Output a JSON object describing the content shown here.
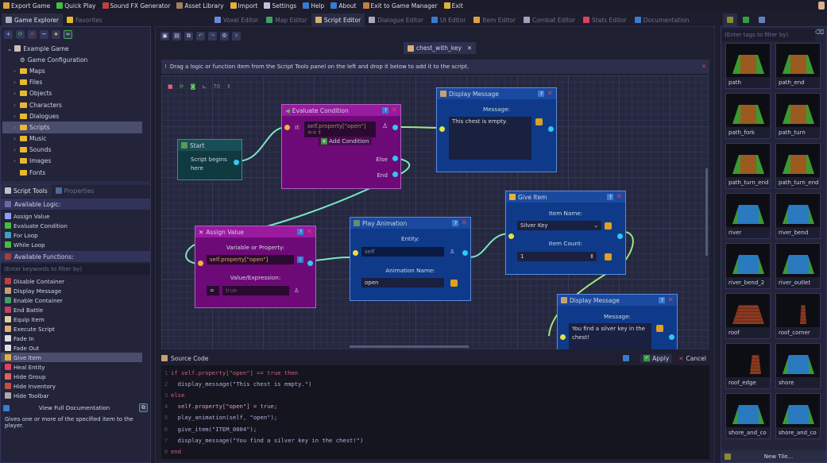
{
  "menu": [
    "Export Game",
    "Quick Play",
    "Sound FX Generator",
    "Asset Library",
    "Import",
    "Settings",
    "Help",
    "About",
    "Exit to Game Manager",
    "Exit"
  ],
  "left_tabs": [
    "Game Explorer",
    "Favorites"
  ],
  "editor_tabs": [
    "Voxel Editor",
    "Map Editor",
    "Script Editor",
    "Dialogue Editor",
    "UI Editor",
    "Item Editor",
    "Combat Editor",
    "Stats Editor",
    "Documentation"
  ],
  "active_editor_tab": "Script Editor",
  "tree": {
    "root": "Example Game",
    "items": [
      "Game Configuration",
      "Maps",
      "Files",
      "Objects",
      "Characters",
      "Dialogues",
      "Scripts",
      "Music",
      "Sounds",
      "Images",
      "Fonts"
    ],
    "selected": "Scripts"
  },
  "tool_tabs": [
    "Script Tools",
    "Properties"
  ],
  "logic": {
    "header": "Available Logic:",
    "items": [
      "Assign Value",
      "Evaluate Condition",
      "For Loop",
      "While Loop"
    ]
  },
  "functions": {
    "header": "Available Functions:",
    "placeholder": "(Enter keywords to filter by)",
    "items": [
      "Disable Container",
      "Display Message",
      "Enable Container",
      "End Battle",
      "Equip Item",
      "Execute Script",
      "Fade In",
      "Fade Out",
      "Give Item",
      "Heal Entity",
      "Hide Group",
      "Hide Inventory",
      "Hide Toolbar"
    ],
    "selected": "Give Item"
  },
  "view_docs": "View Full Documentation",
  "description": "Gives one or more of the specified item to the player.",
  "script_tab": "chest_with_key",
  "hint": "Drag a logic or function item from the Script Tools panel on the left and drop it below to add it to the script.",
  "zoom": "70",
  "nodes": {
    "start": {
      "title": "Start",
      "text": "Script begins here"
    },
    "evaluate": {
      "title": "Evaluate Condition",
      "if_label": "If:",
      "condition": "self.property[\"open\"] == t",
      "add": "Add Condition",
      "else": "Else",
      "end": "End"
    },
    "display1": {
      "title": "Display Message",
      "label": "Message:",
      "value": "This chest is empty."
    },
    "assign": {
      "title": "Assign Value",
      "label1": "Variable or Property:",
      "variable": "self.property[\"open\"]",
      "label2": "Value/Expression:",
      "op": "=",
      "value": "true"
    },
    "play": {
      "title": "Play Animation",
      "label1": "Entity:",
      "entity": "self",
      "label2": "Animation Name:",
      "anim": "open"
    },
    "give": {
      "title": "Give Item",
      "label1": "Item Name:",
      "item": "Silver Key",
      "label2": "Item Count:",
      "count": "1"
    },
    "display2": {
      "title": "Display Message",
      "label": "Message:",
      "value": "You find a silver key in the chest!"
    }
  },
  "source": {
    "title": "Source Code",
    "apply": "Apply",
    "cancel": "Cancel",
    "lines": [
      "if self.property[\"open\"] == true then",
      "  display_message(\"This chest is empty.\")",
      "else",
      "  self.property[\"open\"] = true;",
      "  play_animation(self, \"open\");",
      "  give_item(\"ITEM_0004\");",
      "  display_message(\"You find a silver key in the chest!\")",
      "end"
    ]
  },
  "tiles": {
    "placeholder": "(Enter tags to filter by)",
    "items": [
      "path",
      "path_end",
      "path_fork",
      "path_turn",
      "path_turn_end",
      "path_turn_end",
      "river",
      "river_bend",
      "river_bend_2",
      "river_outlet",
      "roof",
      "roof_corner",
      "roof_edge",
      "shore",
      "shore_and_co",
      "shore_and_co"
    ],
    "new_tile": "New Tile..."
  },
  "colors": {
    "logic_node": "#6e0a78",
    "function_node": "#0f3a8a",
    "start_node": "#0f3a40",
    "accent": "#3a7ad0"
  }
}
